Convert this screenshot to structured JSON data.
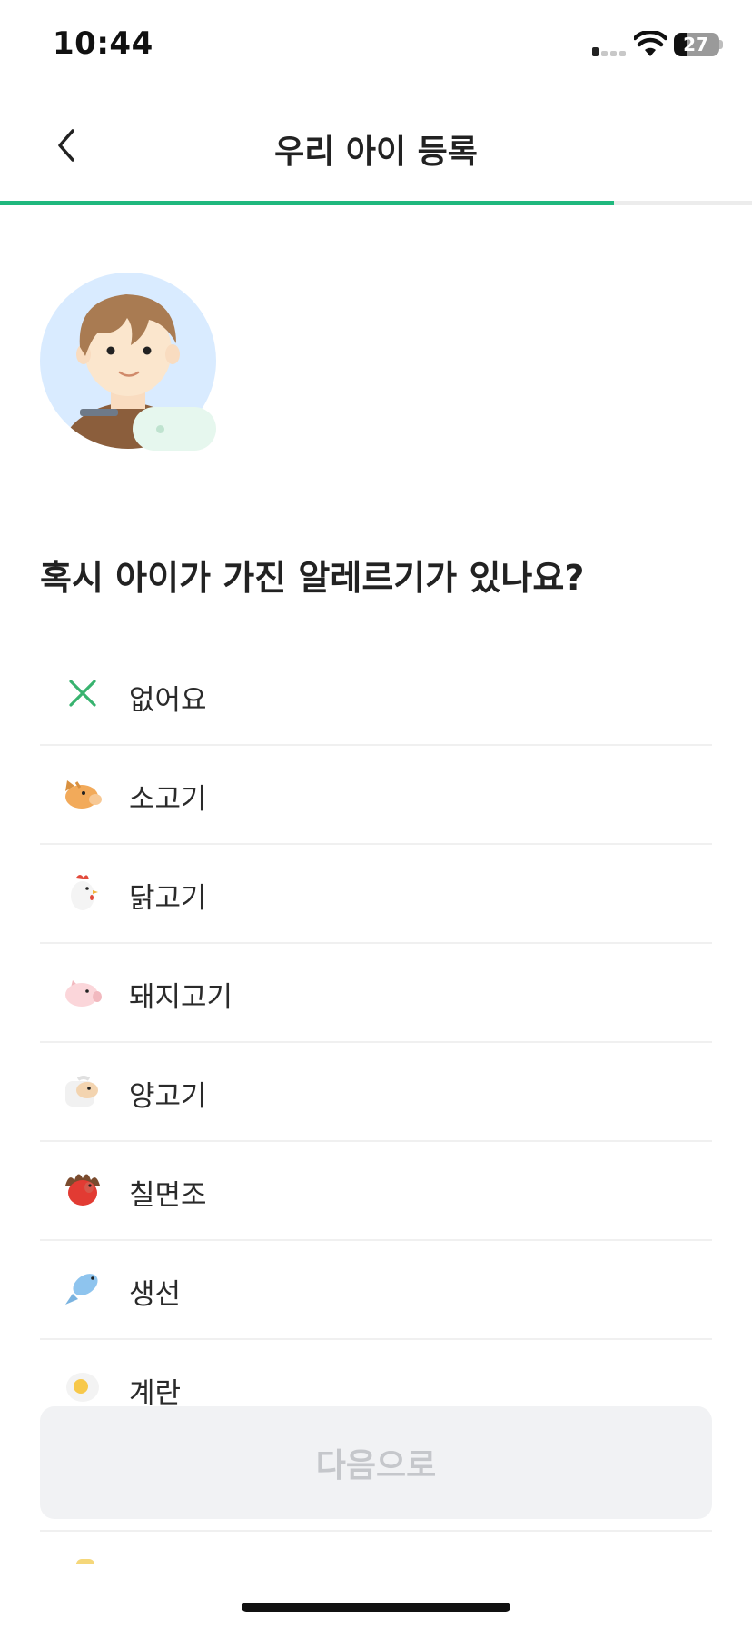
{
  "status_bar": {
    "time": "10:44",
    "battery": "27"
  },
  "header": {
    "title": "우리 아이 등록"
  },
  "progress": {
    "fraction": 0.817,
    "color": "#20b87e"
  },
  "question": "혹시 아이가 가진 알레르기가 있나요?",
  "options": [
    {
      "label": "없어요",
      "icon": "close-x-icon"
    },
    {
      "label": "소고기",
      "icon": "cow-icon"
    },
    {
      "label": "닭고기",
      "icon": "chicken-icon"
    },
    {
      "label": "돼지고기",
      "icon": "pig-icon"
    },
    {
      "label": "양고기",
      "icon": "sheep-icon"
    },
    {
      "label": "칠면조",
      "icon": "turkey-icon"
    },
    {
      "label": "생선",
      "icon": "fish-icon"
    },
    {
      "label": "계란",
      "icon": "egg-icon"
    }
  ],
  "next_button": {
    "label": "다음으로"
  },
  "colors": {
    "accent": "#20b87e",
    "button_disabled_bg": "#f1f2f4",
    "button_disabled_text": "#c5c7cb"
  }
}
